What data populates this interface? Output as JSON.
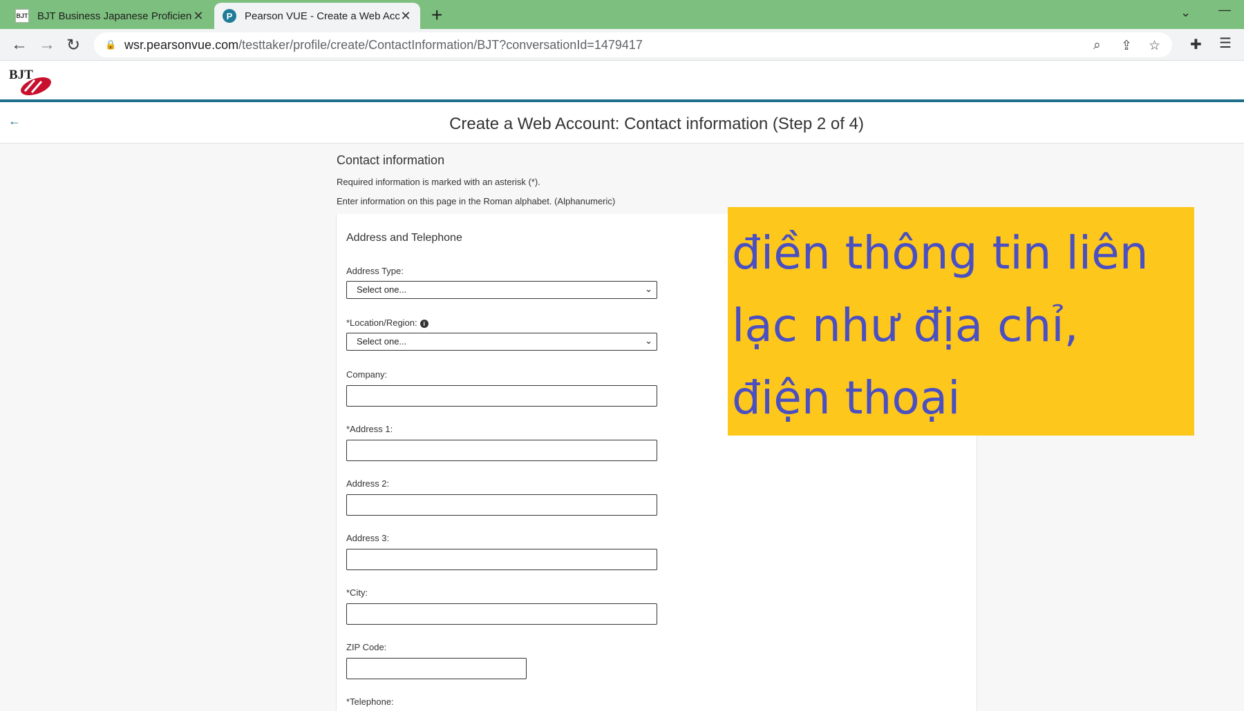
{
  "browser": {
    "tabs": [
      {
        "title": "BJT Business Japanese Proficienc",
        "favicon": "BJT"
      },
      {
        "title": "Pearson VUE - Create a Web Acc",
        "favicon": "P"
      }
    ],
    "url_host": "wsr.pearsonvue.com",
    "url_path": "/testtaker/profile/create/ContactInformation/BJT?conversationId=1479417"
  },
  "page": {
    "logo_text": "BJT",
    "step_title": "Create a Web Account: Contact information (Step 2 of 4)",
    "section_title": "Contact information",
    "note_required": "Required information is marked with an asterisk (*).",
    "note_roman": "Enter information on this page in the Roman alphabet. (Alphanumeric)",
    "card_title": "Address and Telephone",
    "fields": {
      "address_type_label": "Address Type:",
      "address_type_value": "Select one...",
      "location_label": "*Location/Region:",
      "location_value": "Select one...",
      "company_label": "Company:",
      "address1_label": "*Address 1:",
      "address2_label": "Address 2:",
      "address3_label": "Address 3:",
      "city_label": "*City:",
      "zip_label": "ZIP Code:",
      "telephone_label": "*Telephone:"
    }
  },
  "overlay": {
    "line1": "điền thông tin liên",
    "line2": "lạc như địa chỉ,",
    "line3": "điện thoại",
    "background": "#fdc71c",
    "text_color": "#4a4fc2"
  }
}
